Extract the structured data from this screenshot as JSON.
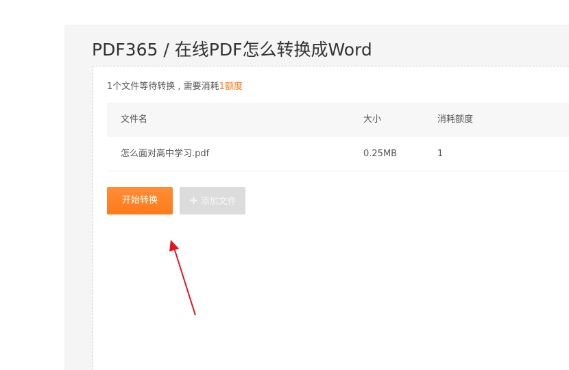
{
  "header": {
    "title": "PDF365 / 在线PDF怎么转换成Word"
  },
  "info": {
    "prefix": "1个文件等待转换 , 需要消耗",
    "credit": "1额度"
  },
  "table": {
    "columns": [
      "文件名",
      "大小",
      "消耗额度"
    ],
    "rows": [
      {
        "name": "怎么面对高中学习.pdf",
        "size": "0.25MB",
        "credits": "1"
      }
    ]
  },
  "actions": {
    "start_label": "开始转换",
    "add_label": "添加文件"
  },
  "colors": {
    "accent": "#ff7a1a",
    "annotation_arrow": "#e8141b"
  },
  "icons": {
    "add": "plus-icon"
  }
}
